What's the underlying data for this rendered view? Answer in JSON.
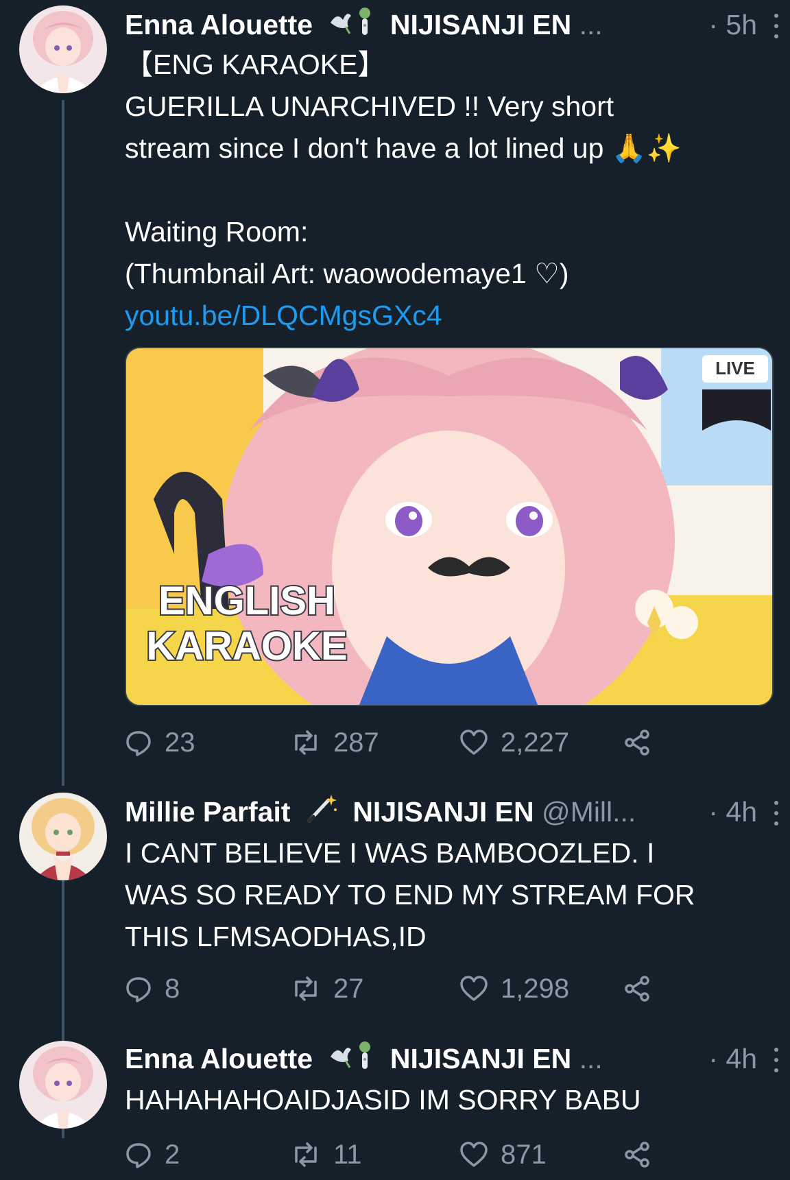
{
  "tweets": [
    {
      "name": "Enna Alouette",
      "org": "NIJISANJI EN",
      "handle": "...",
      "time": "· 5h",
      "lines": [
        "【ENG KARAOKE】",
        "GUERILLA UNARCHIVED !! Very short",
        "stream since I don't have a lot lined up 🙏✨",
        "",
        "Waiting Room:",
        "(Thumbnail Art: waowodemaye1 ♡)"
      ],
      "link": "youtu.be/DLQCMgsGXc4",
      "media": {
        "badge": "LIVE",
        "title_line1": "ENGLISH",
        "title_line2": "KARAOKE"
      },
      "replies": "23",
      "retweets": "287",
      "likes": "2,227"
    },
    {
      "name": "Millie Parfait",
      "org": "NIJISANJI EN",
      "handle": "@Mill...",
      "time": "· 4h",
      "lines": [
        "I CANT BELIEVE I WAS BAMBOOZLED. I",
        "WAS SO READY TO END MY STREAM FOR",
        "THIS LFMSAODHAS,ID"
      ],
      "replies": "8",
      "retweets": "27",
      "likes": "1,298"
    },
    {
      "name": "Enna Alouette",
      "org": "NIJISANJI EN",
      "handle": "...",
      "time": "· 4h",
      "lines": [
        "HAHAHAHOAIDJASID IM SORRY BABU"
      ],
      "replies": "2",
      "retweets": "11",
      "likes": "871"
    }
  ],
  "icons": {
    "reply": "reply-icon",
    "retweet": "retweet-icon",
    "like": "heart-icon",
    "share": "share-icon",
    "more": "more-dots-icon"
  },
  "colors": {
    "background": "#15202b",
    "secondary_text": "#8b98a5",
    "link": "#1d9bf0",
    "thread_line": "#3d5466"
  }
}
